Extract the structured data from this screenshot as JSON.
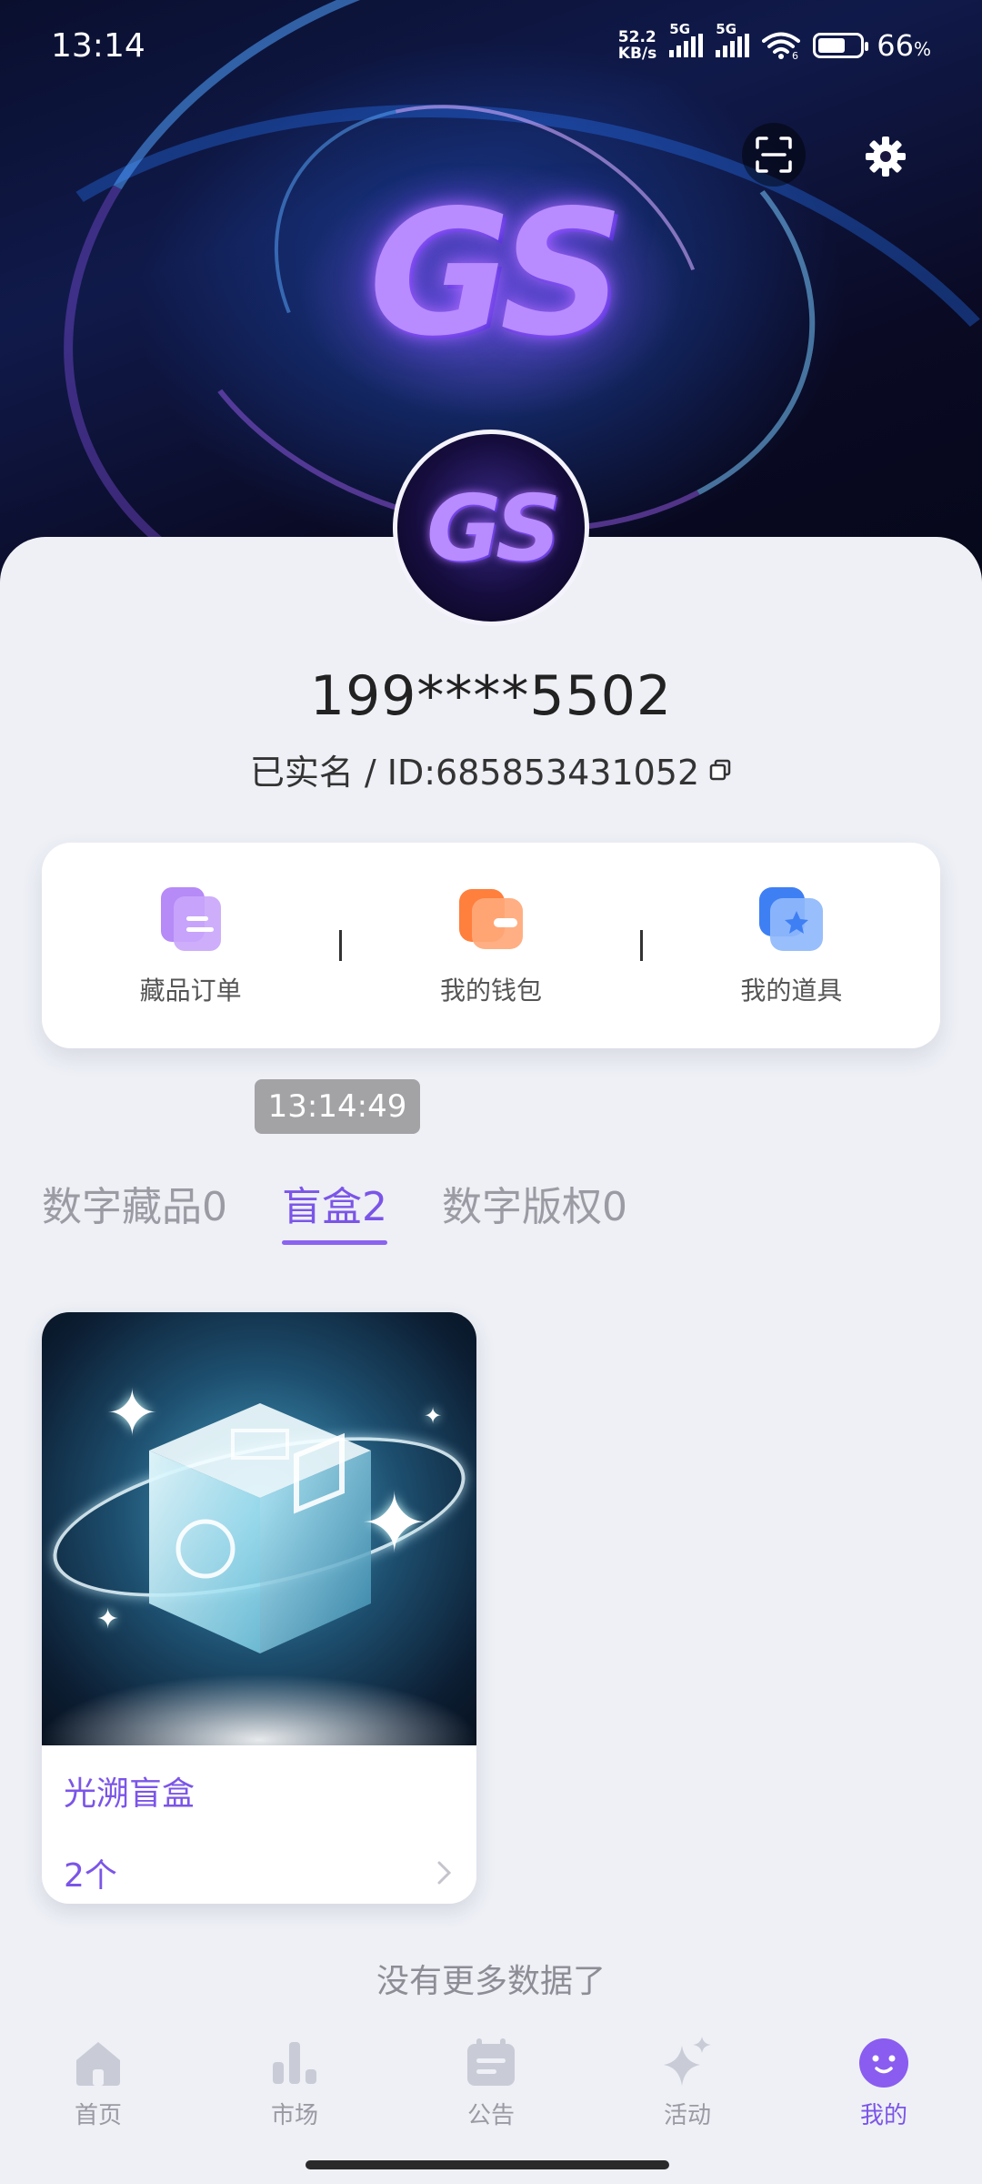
{
  "status_bar": {
    "time": "13:14",
    "net_speed_value": "52.2",
    "net_speed_unit": "KB/s",
    "sim1": "5G",
    "sim2": "5G",
    "wifi_badge": "6",
    "battery_percent": "66",
    "battery_unit": "%",
    "battery_level": 0.66
  },
  "header": {
    "banner_logo": "GS",
    "avatar_logo": "GS",
    "scan_icon": "scan-icon",
    "settings_icon": "gear-icon"
  },
  "profile": {
    "username": "199****5502",
    "id_line": "已实名 / ID:685853431052",
    "copy_icon": "copy-icon"
  },
  "shortcuts": [
    {
      "label": "藏品订单",
      "icon": "order-icon",
      "color": "#a77bf3"
    },
    {
      "label": "我的钱包",
      "icon": "wallet-icon",
      "color": "#ff8a4c"
    },
    {
      "label": "我的道具",
      "icon": "props-icon",
      "color": "#4f8df5"
    }
  ],
  "toast": "13:14:49",
  "tabs": [
    {
      "label": "数字藏品0",
      "active": false
    },
    {
      "label": "盲盒2",
      "active": true
    },
    {
      "label": "数字版权0",
      "active": false
    }
  ],
  "items": [
    {
      "name": "光溯盲盒",
      "count": "2个"
    }
  ],
  "no_more": "没有更多数据了",
  "bottom_nav": [
    {
      "label": "首页",
      "icon": "home-icon"
    },
    {
      "label": "市场",
      "icon": "market-chart-icon"
    },
    {
      "label": "公告",
      "icon": "announcement-icon"
    },
    {
      "label": "活动",
      "icon": "sparkle-icon"
    },
    {
      "label": "我的",
      "icon": "profile-face-icon",
      "active": true
    }
  ],
  "colors": {
    "accent": "#7b55e8",
    "background": "#eef0f6",
    "inactive": "#9a9aa3"
  }
}
